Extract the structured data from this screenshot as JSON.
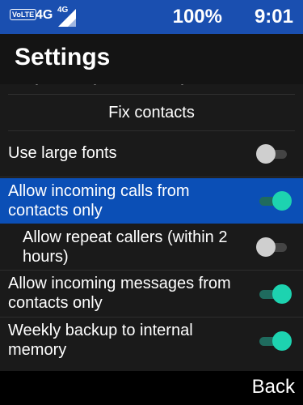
{
  "status_bar": {
    "volte": "VoLTE",
    "network": "4G",
    "signal_label": "4G",
    "signal_icon": "signal-icon",
    "battery": "100%",
    "time": "9:01"
  },
  "header": {
    "title": "Settings"
  },
  "items": [
    {
      "label": "Fix contacts"
    },
    {
      "label": "Use large fonts",
      "toggle": "off"
    },
    {
      "label": "Allow incoming calls from contacts only",
      "toggle": "on",
      "selected": true
    },
    {
      "label": "Allow repeat callers (within 2 hours)",
      "toggle": "off"
    },
    {
      "label": "Allow incoming messages from contacts only",
      "toggle": "on"
    },
    {
      "label": "Weekly backup to internal memory",
      "toggle": "on"
    }
  ],
  "softkeys": {
    "right": "Back"
  },
  "colors": {
    "status_bar": "#1a4fb0",
    "selected_row": "#0b4fb6",
    "toggle_on": "#1dd3b0"
  }
}
